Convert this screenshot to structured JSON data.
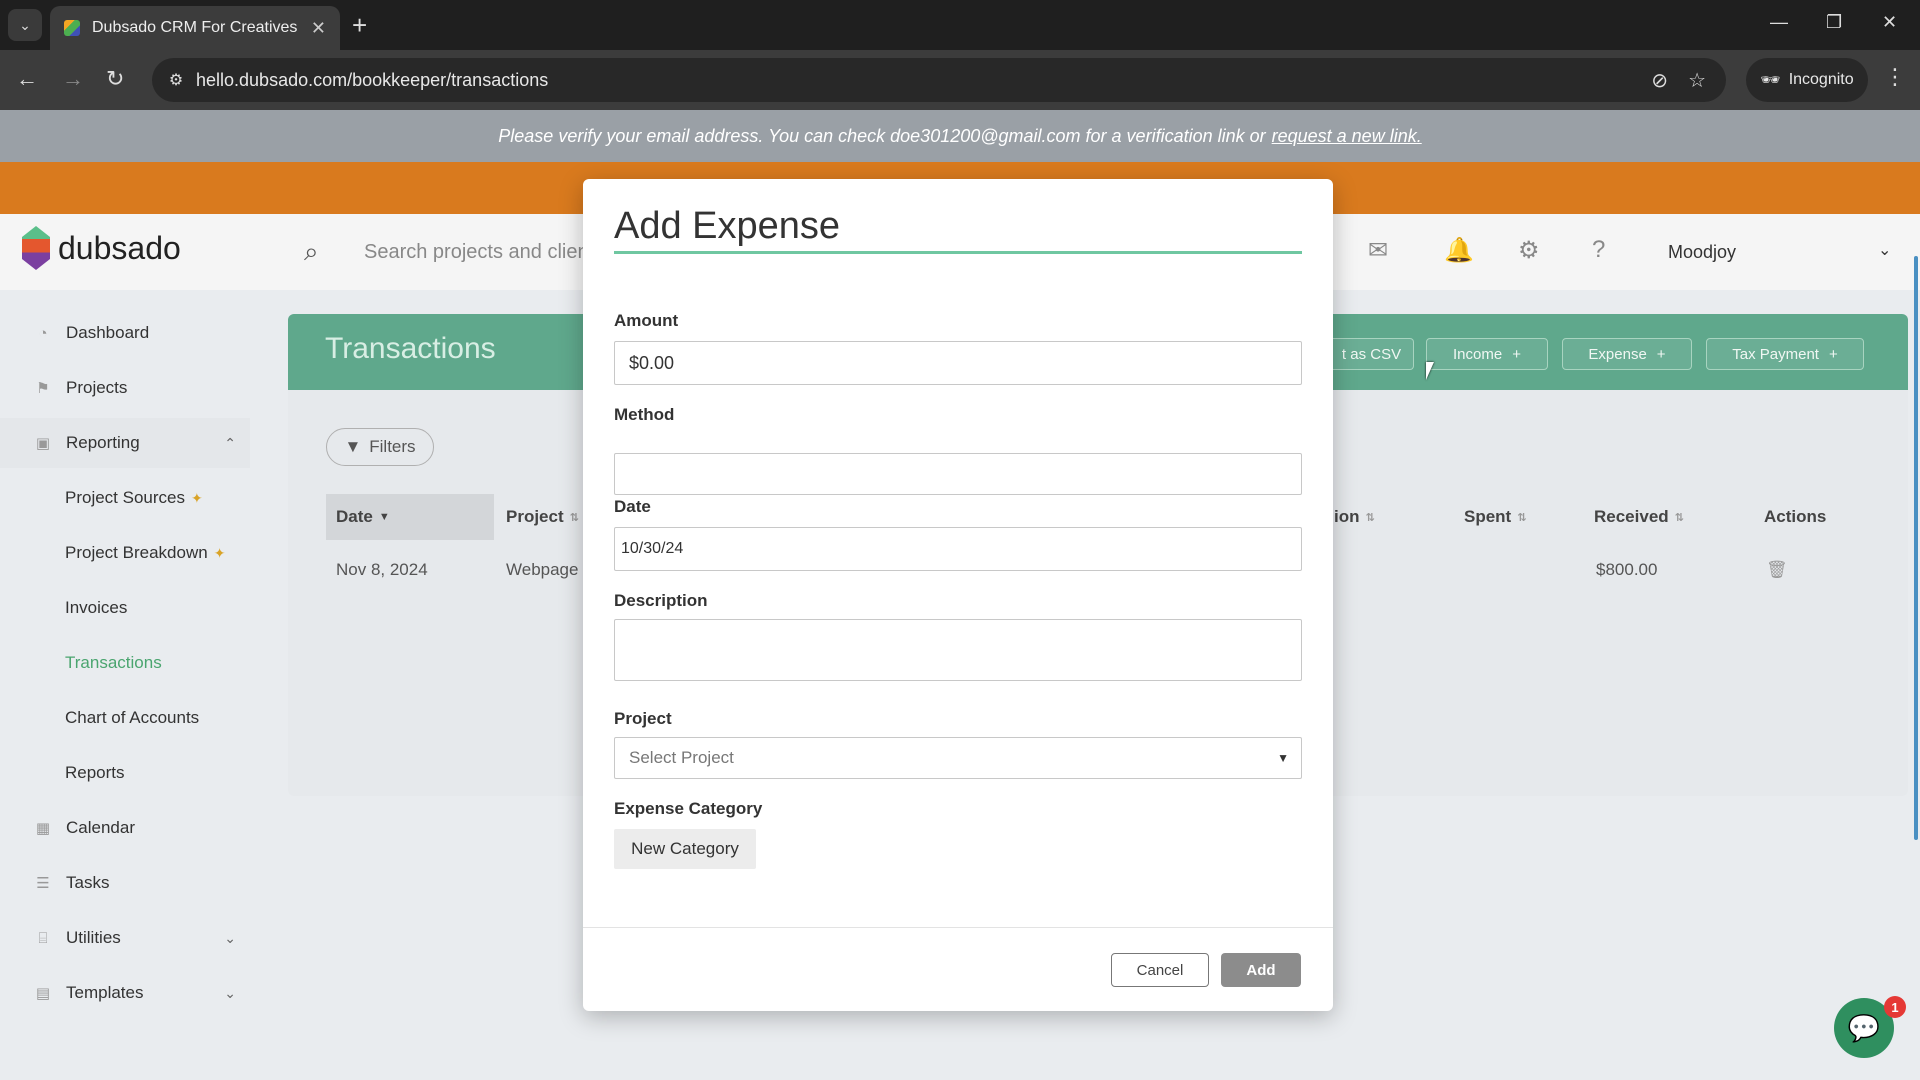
{
  "browser": {
    "tab_title": "Dubsado CRM For Creatives",
    "url": "hello.dubsado.com/bookkeeper/transactions",
    "incognito_label": "Incognito"
  },
  "banner": {
    "verify_text": "Please verify your email address. You can check doe301200@gmail.com for a verification link or",
    "verify_link": "request a new link."
  },
  "header": {
    "logo_text": "dubsado",
    "search_placeholder": "Search projects and clients",
    "user_name": "Moodjoy"
  },
  "sidebar": {
    "items": [
      {
        "label": "Dashboard"
      },
      {
        "label": "Projects"
      },
      {
        "label": "Reporting"
      },
      {
        "label": "Project Sources"
      },
      {
        "label": "Project Breakdown"
      },
      {
        "label": "Invoices"
      },
      {
        "label": "Transactions"
      },
      {
        "label": "Chart of Accounts"
      },
      {
        "label": "Reports"
      },
      {
        "label": "Calendar"
      },
      {
        "label": "Tasks"
      },
      {
        "label": "Utilities"
      },
      {
        "label": "Templates"
      }
    ]
  },
  "main": {
    "title": "Transactions",
    "buttons": {
      "export": "t as CSV",
      "income": "Income",
      "expense": "Expense",
      "tax": "Tax Payment"
    },
    "filters_label": "Filters",
    "columns": {
      "date": "Date",
      "project": "Project",
      "description": "ion",
      "spent": "Spent",
      "received": "Received",
      "actions": "Actions"
    },
    "rows": [
      {
        "date": "Nov 8, 2024",
        "project": "Webpage",
        "received": "$800.00"
      }
    ]
  },
  "modal": {
    "title": "Add Expense",
    "amount_label": "Amount",
    "amount_value": "$0.00",
    "method_label": "Method",
    "date_label": "Date",
    "date_value": "10/30/24",
    "description_label": "Description",
    "project_label": "Project",
    "project_placeholder": "Select Project",
    "category_label": "Expense Category",
    "new_category": "New Category",
    "cancel": "Cancel",
    "add": "Add"
  },
  "chat": {
    "badge": "1"
  },
  "colors": {
    "accent": "#5fa88c",
    "brand_orange": "#d97a1e",
    "active": "#4aa56f"
  }
}
